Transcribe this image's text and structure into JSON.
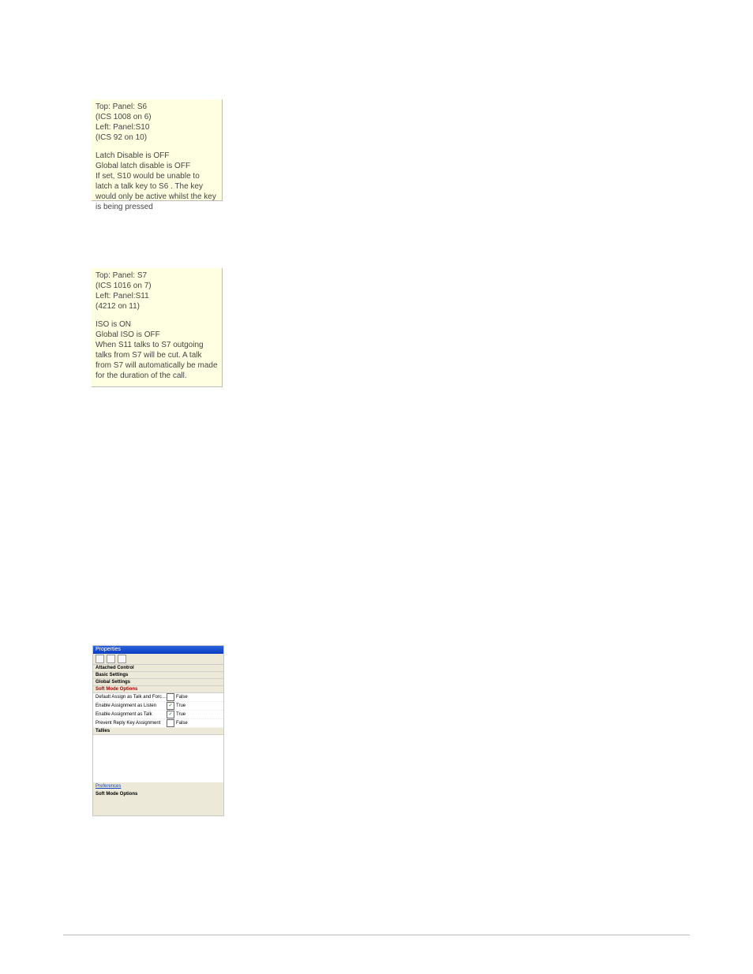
{
  "note1": {
    "header": [
      "Top: Panel: S6",
      "(ICS 1008 on 6)",
      "Left: Panel:S10",
      "(ICS 92 on 10)"
    ],
    "body": "Latch Disable is OFF\nGlobal latch disable is OFF\nIf set, S10   would be unable to latch a talk key to S6   . The key would only be active whilst the key is being pressed"
  },
  "note2": {
    "header": [
      "Top: Panel: S7",
      "(ICS 1016 on 7)",
      "Left: Panel:S11",
      "(4212 on 11)"
    ],
    "body": "ISO is ON\nGlobal ISO is OFF\nWhen S11   talks to S7   outgoing talks from S7    will be cut. A talk from S7    will automatically be made for the duration of the call."
  },
  "properties": {
    "title": "Properties",
    "sections": {
      "attached": "Attached Control",
      "basic": "Basic Settings",
      "global": "Global Settings",
      "softmode": "Soft Mode Options",
      "tallies": "Tallies"
    },
    "rows": [
      {
        "label": "Default Assign as Talk and Forced Listen",
        "checked": false,
        "value": "False"
      },
      {
        "label": "Enable Assignment as Listen",
        "checked": true,
        "value": "True"
      },
      {
        "label": "Enable Assignment as Talk",
        "checked": true,
        "value": "True"
      },
      {
        "label": "Prevent Reply Key Assignment",
        "checked": false,
        "value": "False"
      }
    ],
    "link": "Preferences",
    "footer_title": "Soft Mode Options"
  }
}
